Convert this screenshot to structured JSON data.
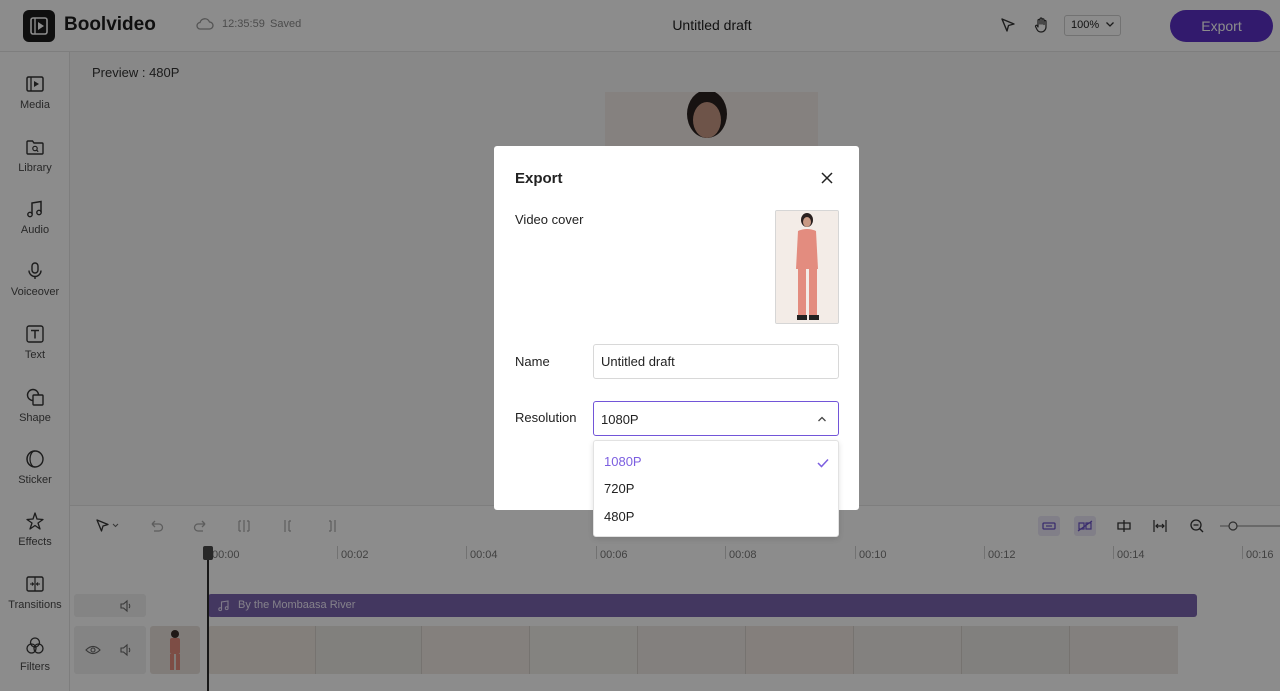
{
  "app": {
    "name": "Boolvideo",
    "save_time": "12:35:59",
    "save_status": "Saved",
    "draft_title": "Untitled draft",
    "zoom": "100%",
    "export_label": "Export",
    "accent_color": "#5b31c7"
  },
  "sidebar": {
    "items": [
      {
        "label": "Media",
        "icon": "media-icon"
      },
      {
        "label": "Library",
        "icon": "library-icon"
      },
      {
        "label": "Audio",
        "icon": "music-note-icon"
      },
      {
        "label": "Voiceover",
        "icon": "microphone-icon"
      },
      {
        "label": "Text",
        "icon": "text-icon"
      },
      {
        "label": "Shape",
        "icon": "shape-icon"
      },
      {
        "label": "Sticker",
        "icon": "sticker-icon"
      },
      {
        "label": "Effects",
        "icon": "sparkle-icon"
      },
      {
        "label": "Transitions",
        "icon": "transitions-icon"
      },
      {
        "label": "Filters",
        "icon": "filters-icon"
      }
    ]
  },
  "preview": {
    "label": "Preview : 480P"
  },
  "timeline": {
    "ticks": [
      "00:00",
      "00:02",
      "00:04",
      "00:06",
      "00:08",
      "00:10",
      "00:12",
      "00:14",
      "00:16"
    ],
    "audio_track": "By the Mombaasa River"
  },
  "modal": {
    "title": "Export",
    "video_cover_label": "Video cover",
    "name_label": "Name",
    "name_value": "Untitled draft",
    "resolution_label": "Resolution",
    "resolution_value": "1080P",
    "resolution_options": [
      "1080P",
      "720P",
      "480P"
    ],
    "selected_option": "1080P"
  }
}
